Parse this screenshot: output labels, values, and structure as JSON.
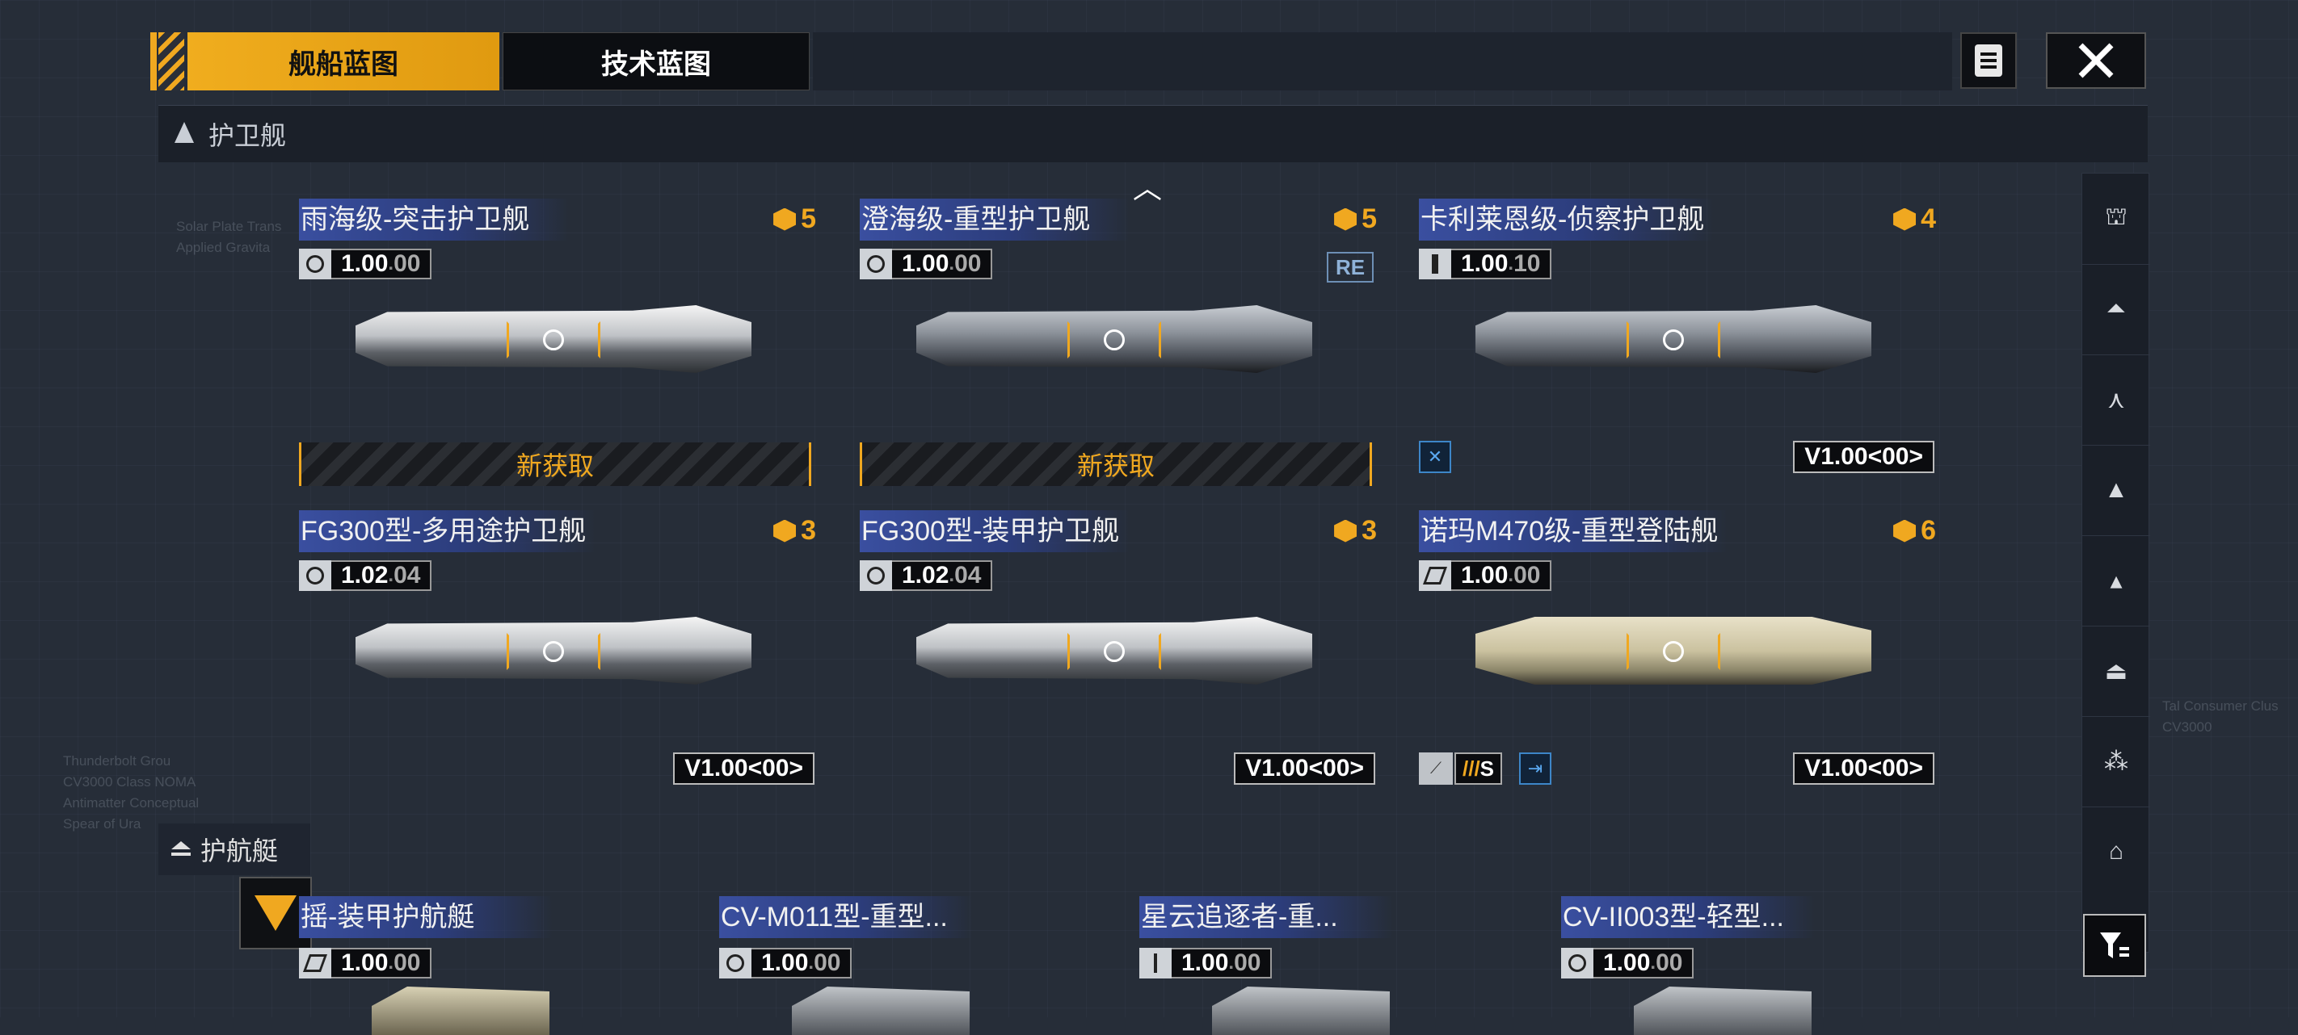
{
  "tabs": {
    "ship_blueprint": "舰船蓝图",
    "tech_blueprint": "技术蓝图"
  },
  "sections": {
    "frigate": "护卫舰",
    "corvette": "护航艇"
  },
  "ships": [
    {
      "name": "雨海级-突击护卫舰",
      "cost": "5",
      "version": "1.00",
      "version_sub": "00",
      "manufacturer_icon": "helmet-icon",
      "new_label": "新获取"
    },
    {
      "name": "澄海级-重型护卫舰",
      "cost": "5",
      "version": "1.00",
      "version_sub": "00",
      "manufacturer_icon": "helmet-icon",
      "badge": "RE",
      "new_label": "新获取"
    },
    {
      "name": "卡利莱恩级-侦察护卫舰",
      "cost": "4",
      "version": "1.00",
      "version_sub": "10",
      "manufacturer_icon": "rocket-icon",
      "model_version": "V1.00<00>"
    },
    {
      "name": "FG300型-多用途护卫舰",
      "cost": "3",
      "version": "1.02",
      "version_sub": "04",
      "manufacturer_icon": "globe-icon",
      "model_version": "V1.00<00>"
    },
    {
      "name": "FG300型-装甲护卫舰",
      "cost": "3",
      "version": "1.02",
      "version_sub": "04",
      "manufacturer_icon": "globe-icon",
      "model_version": "V1.00<00>"
    },
    {
      "name": "诺玛M470级-重型登陆舰",
      "cost": "6",
      "version": "1.00",
      "version_sub": "00",
      "manufacturer_icon": "nomad-icon",
      "model_version": "V1.00<00>",
      "feature_tag": "S"
    }
  ],
  "bottom_ships": [
    {
      "name": "摇-装甲护航艇",
      "version": "1.00",
      "version_sub": "00",
      "manufacturer_icon": "nomad-icon"
    },
    {
      "name": "CV-M011型-重型...",
      "version": "1.00",
      "version_sub": "00",
      "manufacturer_icon": "globe-icon"
    },
    {
      "name": "星云追逐者-重...",
      "version": "1.00",
      "version_sub": "00",
      "manufacturer_icon": "anchor-icon"
    },
    {
      "name": "CV-II003型-轻型...",
      "version": "1.00",
      "version_sub": "00",
      "manufacturer_icon": "globe-icon"
    }
  ],
  "side_nav": [
    "battleship-icon",
    "cruiser-icon",
    "destroyer-icon",
    "frigate-icon",
    "corvette-icon",
    "carrier-icon",
    "fighter-icon",
    "auxiliary-icon"
  ],
  "accent": "#f0a820"
}
